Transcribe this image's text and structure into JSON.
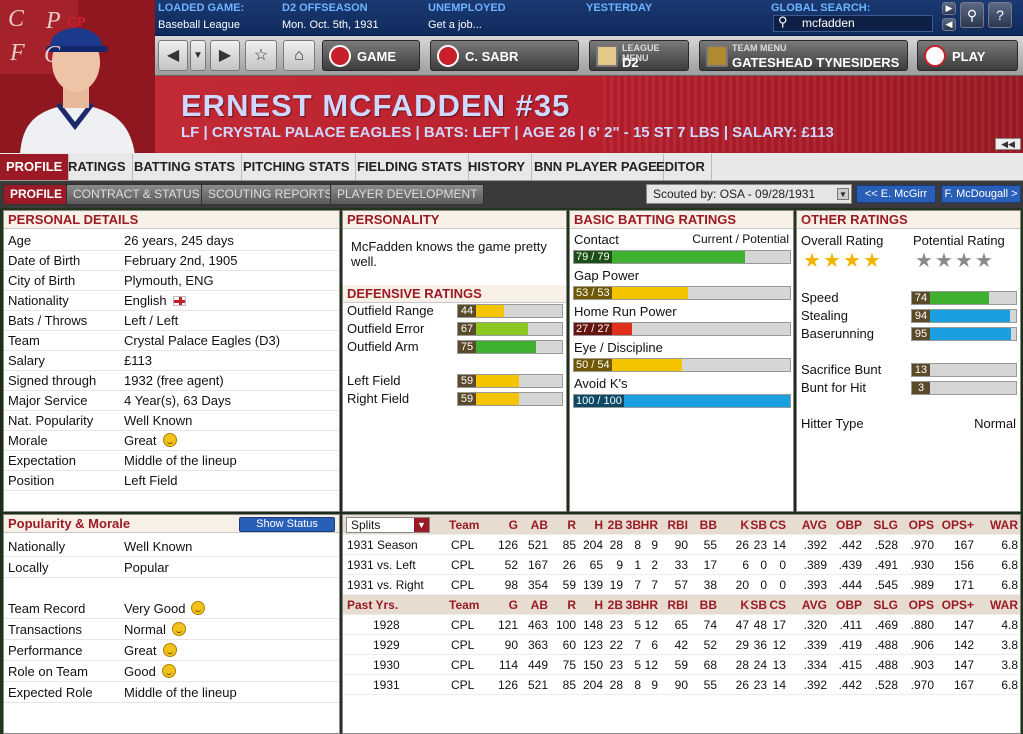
{
  "topbar": {
    "loaded_game": {
      "label": "LOADED GAME:",
      "value": "Baseball League"
    },
    "phase": {
      "label": "D2 OFFSEASON",
      "value": "Mon. Oct. 5th, 1931"
    },
    "status": {
      "label": "UNEMPLOYED",
      "value": "Get a job..."
    },
    "yesterday": {
      "label": "YESTERDAY"
    },
    "search": {
      "label": "GLOBAL SEARCH:",
      "value": "mcfadden"
    }
  },
  "logo": {
    "letters": [
      "C",
      "P",
      "F",
      "C"
    ],
    "cap_letters": "CP"
  },
  "nav": {
    "game_label": "GAME",
    "sabr_label": "C. SABR",
    "league_menu": {
      "small": "LEAGUE MENU",
      "main": "D2"
    },
    "team_menu": {
      "small": "TEAM MENU",
      "main": "GATESHEAD TYNESIDERS"
    },
    "play_label": "PLAY"
  },
  "player": {
    "name": "ERNEST MCFADDEN  #35",
    "info": "LF | CRYSTAL PALACE EAGLES | BATS: LEFT | AGE 26 | 6' 2\" - 15 ST 7 LBS | SALARY: £113"
  },
  "tabs": [
    "PROFILE",
    "RATINGS",
    "BATTING STATS",
    "PITCHING STATS",
    "FIELDING STATS",
    "HISTORY",
    "BNN PLAYER PAGE",
    "EDITOR"
  ],
  "subtabs": [
    "PROFILE",
    "CONTRACT & STATUS",
    "SCOUTING REPORTS",
    "PLAYER DEVELOPMENT"
  ],
  "scouted": "Scouted by: OSA - 09/28/1931",
  "prev_player": "<< E. McGirr",
  "next_player": "F. McDougall >",
  "personal": {
    "title": "PERSONAL DETAILS",
    "rows": [
      {
        "k": "Age",
        "v": "26 years, 245 days"
      },
      {
        "k": "Date of Birth",
        "v": "February 2nd, 1905"
      },
      {
        "k": "City of Birth",
        "v": "Plymouth, ENG"
      },
      {
        "k": "Nationality",
        "v": "English"
      },
      {
        "k": "Bats / Throws",
        "v": "Left / Left"
      },
      {
        "k": "Team",
        "v": "Crystal Palace Eagles (D3)"
      },
      {
        "k": "Salary",
        "v": "£113"
      },
      {
        "k": "Signed through",
        "v": "1932 (free agent)"
      },
      {
        "k": "Major Service",
        "v": "4 Year(s), 63 Days"
      },
      {
        "k": "Nat. Popularity",
        "v": "Well Known"
      },
      {
        "k": "Morale",
        "v": "Great"
      },
      {
        "k": "Expectation",
        "v": "Middle of the lineup"
      },
      {
        "k": "Position",
        "v": "Left Field"
      }
    ]
  },
  "popularity": {
    "title": "Popularity & Morale",
    "button": "Show Status",
    "rows": [
      {
        "k": "Nationally",
        "v": "Well Known"
      },
      {
        "k": "Locally",
        "v": "Popular"
      },
      {
        "k": "Team Record",
        "v": "Very Good"
      },
      {
        "k": "Transactions",
        "v": "Normal"
      },
      {
        "k": "Performance",
        "v": "Great"
      },
      {
        "k": "Role on Team",
        "v": "Good"
      },
      {
        "k": "Expected Role",
        "v": "Middle of the lineup"
      }
    ]
  },
  "personality": {
    "title": "PERSONALITY",
    "text": "McFadden knows the game pretty well."
  },
  "defense": {
    "title": "DEFENSIVE RATINGS",
    "items": [
      {
        "label": "Outfield Range",
        "value": 44,
        "color": "#f5c400"
      },
      {
        "label": "Outfield Error",
        "value": 67,
        "color": "#8dc820"
      },
      {
        "label": "Outfield Arm",
        "value": 75,
        "color": "#3fb030"
      },
      {
        "label": "Left Field",
        "value": 59,
        "color": "#f5c400"
      },
      {
        "label": "Right Field",
        "value": 59,
        "color": "#f5c400"
      }
    ]
  },
  "batting": {
    "title": "BASIC BATTING RATINGS",
    "header": "Current / Potential",
    "items": [
      {
        "label": "Contact",
        "text": "79 / 79",
        "value": 79,
        "color": "#3fb030"
      },
      {
        "label": "Gap Power",
        "text": "53 / 53",
        "value": 53,
        "color": "#f5c400"
      },
      {
        "label": "Home Run Power",
        "text": "27 / 27",
        "value": 27,
        "color": "#e0301c"
      },
      {
        "label": "Eye / Discipline",
        "text": "50 / 54",
        "value": 50,
        "color": "#f5c400"
      },
      {
        "label": "Avoid K's",
        "text": "100 / 100",
        "value": 100,
        "color": "#1aa0e0"
      }
    ]
  },
  "other": {
    "title": "OTHER RATINGS",
    "overall_label": "Overall Rating",
    "potential_label": "Potential Rating",
    "overall_stars": 4,
    "potential_stars": 4,
    "items": [
      {
        "label": "Speed",
        "value": 74,
        "color": "#3fb030"
      },
      {
        "label": "Stealing",
        "value": 94,
        "color": "#1aa0e0"
      },
      {
        "label": "Baserunning",
        "value": 95,
        "color": "#1aa0e0"
      },
      {
        "label": "Sacrifice Bunt",
        "value": 13,
        "color": "#8a1a20"
      },
      {
        "label": "Bunt for Hit",
        "value": 3,
        "color": "#555"
      }
    ],
    "hitter_type_label": "Hitter Type",
    "hitter_type": "Normal"
  },
  "stats": {
    "filter": "Splits",
    "headers": [
      "Team",
      "G",
      "AB",
      "R",
      "H",
      "2B",
      "3B",
      "HR",
      "RBI",
      "BB",
      "K",
      "SB",
      "CS",
      "AVG",
      "OBP",
      "SLG",
      "OPS",
      "OPS+",
      "WAR"
    ],
    "splits": [
      {
        "label": "1931 Season",
        "cells": [
          "CPL",
          "126",
          "521",
          "85",
          "204",
          "28",
          "8",
          "9",
          "90",
          "55",
          "26",
          "23",
          "14",
          ".392",
          ".442",
          ".528",
          ".970",
          "167",
          "6.8"
        ]
      },
      {
        "label": "1931 vs. Left",
        "cells": [
          "CPL",
          "52",
          "167",
          "26",
          "65",
          "9",
          "1",
          "2",
          "33",
          "17",
          "6",
          "0",
          "0",
          ".389",
          ".439",
          ".491",
          ".930",
          "156",
          "6.8"
        ]
      },
      {
        "label": "1931 vs. Right",
        "cells": [
          "CPL",
          "98",
          "354",
          "59",
          "139",
          "19",
          "7",
          "7",
          "57",
          "38",
          "20",
          "0",
          "0",
          ".393",
          ".444",
          ".545",
          ".989",
          "171",
          "6.8"
        ]
      }
    ],
    "past_label": "Past Yrs.",
    "past": [
      {
        "label": "1928",
        "cells": [
          "CPL",
          "121",
          "463",
          "100",
          "148",
          "23",
          "5",
          "12",
          "65",
          "74",
          "47",
          "48",
          "17",
          ".320",
          ".411",
          ".469",
          ".880",
          "147",
          "4.8"
        ]
      },
      {
        "label": "1929",
        "cells": [
          "CPL",
          "90",
          "363",
          "60",
          "123",
          "22",
          "7",
          "6",
          "42",
          "52",
          "29",
          "36",
          "12",
          ".339",
          ".419",
          ".488",
          ".906",
          "142",
          "3.8"
        ]
      },
      {
        "label": "1930",
        "cells": [
          "CPL",
          "114",
          "449",
          "75",
          "150",
          "23",
          "5",
          "12",
          "59",
          "68",
          "28",
          "24",
          "13",
          ".334",
          ".415",
          ".488",
          ".903",
          "147",
          "3.8"
        ]
      },
      {
        "label": "1931",
        "cells": [
          "CPL",
          "126",
          "521",
          "85",
          "204",
          "28",
          "8",
          "9",
          "90",
          "55",
          "26",
          "23",
          "14",
          ".392",
          ".442",
          ".528",
          ".970",
          "167",
          "6.8"
        ]
      }
    ]
  }
}
